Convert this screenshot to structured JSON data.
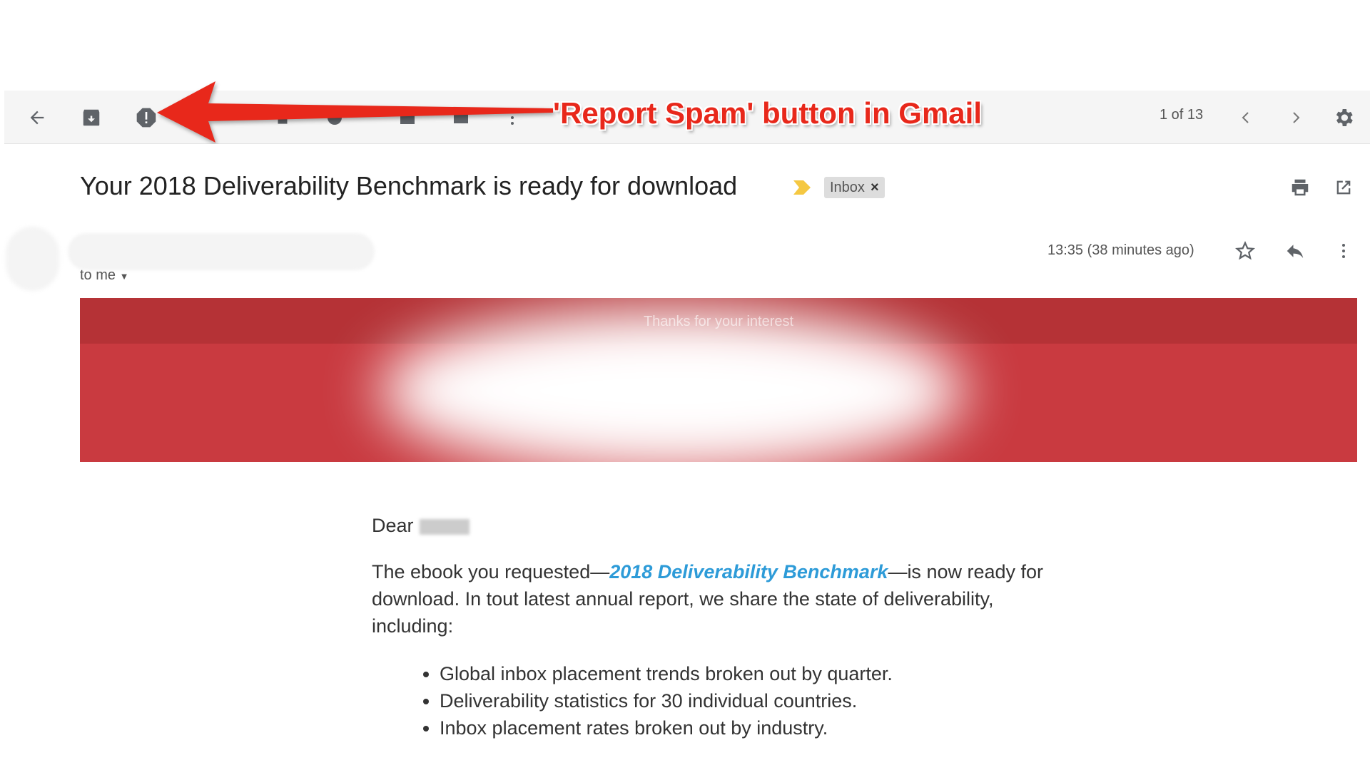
{
  "toolbar": {
    "icons": [
      "back-arrow-icon",
      "archive-icon",
      "report-spam-icon",
      "delete-icon",
      "mark-unread-icon",
      "snooze-icon",
      "move-to-icon",
      "more-vert-icon",
      "chevron-left-icon",
      "chevron-right-icon",
      "gear-icon"
    ],
    "counter": "1 of 13"
  },
  "annotation": {
    "text": "'Report Spam' button in Gmail",
    "color": "#e8281b"
  },
  "email": {
    "subject": "Your 2018 Deliverability Benchmark is ready for download",
    "label": "Inbox",
    "label_remove": "×",
    "to": "to me",
    "time": "13:35 (38 minutes ago)",
    "banner_tagline": "Thanks for your interest",
    "banner_color": "#c93a40",
    "greeting": "Dear",
    "para_before": "The ebook you requested—",
    "link": "2018 Deliverability Benchmark",
    "para_after": "—is now ready for download. In tout latest annual report, we share the state of deliverability, including:",
    "bullets": [
      "Global inbox placement trends broken out by quarter.",
      "Deliverability statistics for 30 individual countries.",
      "Inbox placement rates broken out by industry."
    ]
  }
}
